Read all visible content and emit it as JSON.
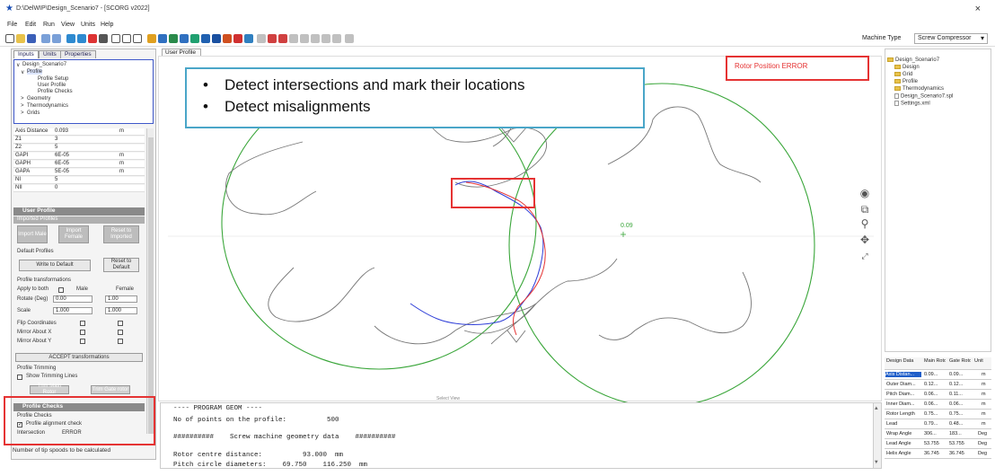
{
  "window": {
    "title": "D:\\DelWIP\\Design_Scenario7 - [SCORG v2022]",
    "close_glyph": "×",
    "app_icon": "star-icon"
  },
  "menu": [
    "File",
    "Edit",
    "Run",
    "View",
    "Units",
    "Help"
  ],
  "toolbar": {
    "machine_type_label": "Machine Type",
    "machine_type_value": "Screw Compressor"
  },
  "left_panel": {
    "tabs": [
      "Inputs",
      "Units",
      "Properties"
    ],
    "tree": [
      {
        "label": "Design_Scenario7",
        "prefix": "∨",
        "indent": 0
      },
      {
        "label": "Profile",
        "prefix": "∨",
        "indent": 1
      },
      {
        "label": "Profile Setup",
        "prefix": "",
        "indent": 3
      },
      {
        "label": "User Profile",
        "prefix": "",
        "indent": 3
      },
      {
        "label": "Profile Checks",
        "prefix": "",
        "indent": 3
      },
      {
        "label": "Geometry",
        "prefix": ">",
        "indent": 1
      },
      {
        "label": "Thermodynamics",
        "prefix": ">",
        "indent": 1
      },
      {
        "label": "Grids",
        "prefix": ">",
        "indent": 1
      }
    ],
    "properties": [
      {
        "name": "Axis Distance",
        "value": "0.093",
        "unit": "m"
      },
      {
        "name": "Z1",
        "value": "3",
        "unit": ""
      },
      {
        "name": "Z2",
        "value": "5",
        "unit": ""
      },
      {
        "name": "GAPI",
        "value": "6E-05",
        "unit": "m"
      },
      {
        "name": "GAPH",
        "value": "6E-05",
        "unit": "m"
      },
      {
        "name": "GAPA",
        "value": "5E-05",
        "unit": "m"
      },
      {
        "name": "NI",
        "value": "5",
        "unit": ""
      },
      {
        "name": "NII",
        "value": "0",
        "unit": ""
      }
    ],
    "user_profile": {
      "title": "User Profile",
      "imported_head": "Imported Profiles",
      "import_male": "Import Male",
      "import_female": "Import Female",
      "reset_imported": "Reset to Imported",
      "default_head": "Default Profiles",
      "write_default": "Write to Default",
      "reset_default": "Reset to Default",
      "transform_head": "Profile transformations",
      "apply_both": "Apply to both",
      "male": "Male",
      "female": "Female",
      "rotate_label": "Rotate (Deg)",
      "rotate_male": "0.00",
      "rotate_female": "1.00",
      "scale_label": "Scale",
      "scale_male": "1.000",
      "scale_female": "1.000",
      "flip": "Flip Coordinates",
      "mirror_x": "Mirror About X",
      "mirror_y": "Mirror About Y",
      "accept": "ACCEPT transformations",
      "trimming_head": "Profile Trimming",
      "show_trimming": "Show Trimming Lines",
      "trim_male": "Trim Main Rotor",
      "trim_gate": "Trim Gate rotor"
    },
    "profile_checks": {
      "title": "Profile Checks",
      "sub": "Profile Checks",
      "alignment": "Profile alignment check",
      "intersection_label": "Intersection",
      "intersection_value": "ERROR"
    },
    "status": "Number of tip spoods to be calculated"
  },
  "viewport": {
    "tab": "User Profile",
    "rotor_error": "Rotor Position ERROR",
    "value_label": "0.09",
    "annotations": [
      "Detect intersections and mark their locations",
      "Detect misalignments"
    ],
    "tools": [
      "eye-icon",
      "zoom-window-icon",
      "zoom-icon",
      "pan-icon",
      "fit-icon"
    ]
  },
  "console": {
    "splitter": "Select View",
    "lines": [
      "---- PROGRAM GEOM ----",
      "No of points on the profile:          500",
      "##########    Screw machine geometry data    ##########",
      "Rotor centre distance:          93.000  mm",
      "Pitch circle diameters:    69.750    116.250  mm"
    ]
  },
  "right_tree": [
    {
      "label": "Design_Scenario7",
      "type": "folder",
      "indent": 0
    },
    {
      "label": "Design",
      "type": "folder",
      "indent": 1
    },
    {
      "label": "Grid",
      "type": "folder",
      "indent": 1
    },
    {
      "label": "Profile",
      "type": "folder",
      "indent": 1
    },
    {
      "label": "Thermodynamics",
      "type": "folder",
      "indent": 1
    },
    {
      "label": "Design_Scenario7.spl",
      "type": "file",
      "indent": 1
    },
    {
      "label": "Settings.xml",
      "type": "file",
      "indent": 1
    }
  ],
  "design_table": {
    "headers": [
      "Design Data",
      "Main Rotor",
      "Gate Rotor",
      "Unit"
    ],
    "rows": [
      [
        "Axis Distan...",
        "0.09...",
        "0.09...",
        "m"
      ],
      [
        "Outer Diam...",
        "0.12...",
        "0.12...",
        "m"
      ],
      [
        "Pitch Diam...",
        "0.06...",
        "0.11...",
        "m"
      ],
      [
        "Inner Diam...",
        "0.06...",
        "0.06...",
        "m"
      ],
      [
        "Rotor Length",
        "0.75...",
        "0.75...",
        "m"
      ],
      [
        "Lead",
        "0.79...",
        "0.48...",
        "m"
      ],
      [
        "Wrap Angle",
        "306...",
        "183...",
        "Deg"
      ],
      [
        "Lead Angle",
        "53.755",
        "53.755",
        "Deg"
      ],
      [
        "Helix Angle",
        "36.745",
        "36.745",
        "Deg"
      ]
    ]
  },
  "colors": {
    "error": "#e53333",
    "annotation_border": "#4aa6c8",
    "casing": "#3aa63a",
    "male_profile": "#2f3fd8",
    "female_profile": "#e53333",
    "tree_border": "#3e57c9"
  }
}
